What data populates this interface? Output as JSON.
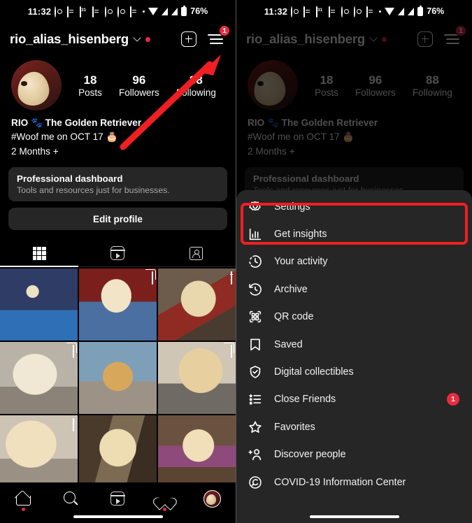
{
  "status_bar": {
    "time": "11:32",
    "battery_percent": "76%",
    "icons": [
      "whatsapp-icon",
      "news-icon",
      "calendar-icon",
      "message-icon",
      "instagram-icon",
      "instagram-icon-2",
      "app-icon",
      "dot-icon",
      "wifi-icon",
      "signal-icon",
      "signal-icon-2",
      "battery-icon"
    ]
  },
  "header": {
    "username": "rio_alias_hisenberg",
    "menu_badge": "1"
  },
  "profile": {
    "stats": [
      {
        "num": "18",
        "label": "Posts"
      },
      {
        "num": "96",
        "label": "Followers"
      },
      {
        "num": "88",
        "label": "Following"
      }
    ],
    "bio_name": "RIO 🐾 The Golden Retriever",
    "bio_line2": "#Woof me on OCT 17 🎂",
    "bio_line3": "2 Months +"
  },
  "dashboard_card": {
    "title": "Professional dashboard",
    "subtitle": "Tools and resources just for businesses."
  },
  "edit_profile_label": "Edit profile",
  "tabs": [
    {
      "name": "grid-tab",
      "icon": "grid-icon",
      "active": true
    },
    {
      "name": "reels-tab",
      "icon": "reels-icon",
      "active": false
    },
    {
      "name": "tagged-tab",
      "icon": "tagged-icon",
      "active": false
    }
  ],
  "photo_grid": [
    {
      "overlay": "none"
    },
    {
      "overlay": "carousel"
    },
    {
      "overlay": "reel"
    },
    {
      "overlay": "carousel"
    },
    {
      "overlay": "none"
    },
    {
      "overlay": "carousel"
    },
    {
      "overlay": "reel"
    },
    {
      "overlay": "none"
    },
    {
      "overlay": "none"
    }
  ],
  "bottom_nav": [
    {
      "name": "home-icon",
      "badge_dot": true
    },
    {
      "name": "search-icon",
      "badge_dot": false
    },
    {
      "name": "reels-icon",
      "badge_dot": false
    },
    {
      "name": "heart-icon",
      "badge_dot": true
    },
    {
      "name": "profile-avatar",
      "badge_dot": false
    }
  ],
  "menu": {
    "items": [
      {
        "label": "Settings",
        "icon": "gear-icon",
        "badge": ""
      },
      {
        "label": "Get insights",
        "icon": "bar-chart-icon",
        "badge": ""
      },
      {
        "label": "Your activity",
        "icon": "clock-dashed-icon",
        "badge": ""
      },
      {
        "label": "Archive",
        "icon": "archive-clock-icon",
        "badge": ""
      },
      {
        "label": "QR code",
        "icon": "qr-code-icon",
        "badge": ""
      },
      {
        "label": "Saved",
        "icon": "bookmark-icon",
        "badge": ""
      },
      {
        "label": "Digital collectibles",
        "icon": "shield-check-icon",
        "badge": ""
      },
      {
        "label": "Close Friends",
        "icon": "list-star-icon",
        "badge": "1"
      },
      {
        "label": "Favorites",
        "icon": "star-icon",
        "badge": ""
      },
      {
        "label": "Discover people",
        "icon": "add-person-icon",
        "badge": ""
      },
      {
        "label": "COVID-19 Information Center",
        "icon": "covid-icon",
        "badge": ""
      }
    ]
  },
  "annotations": {
    "arrow_color": "#ef1f22",
    "highlight_color": "#ef1f22"
  }
}
